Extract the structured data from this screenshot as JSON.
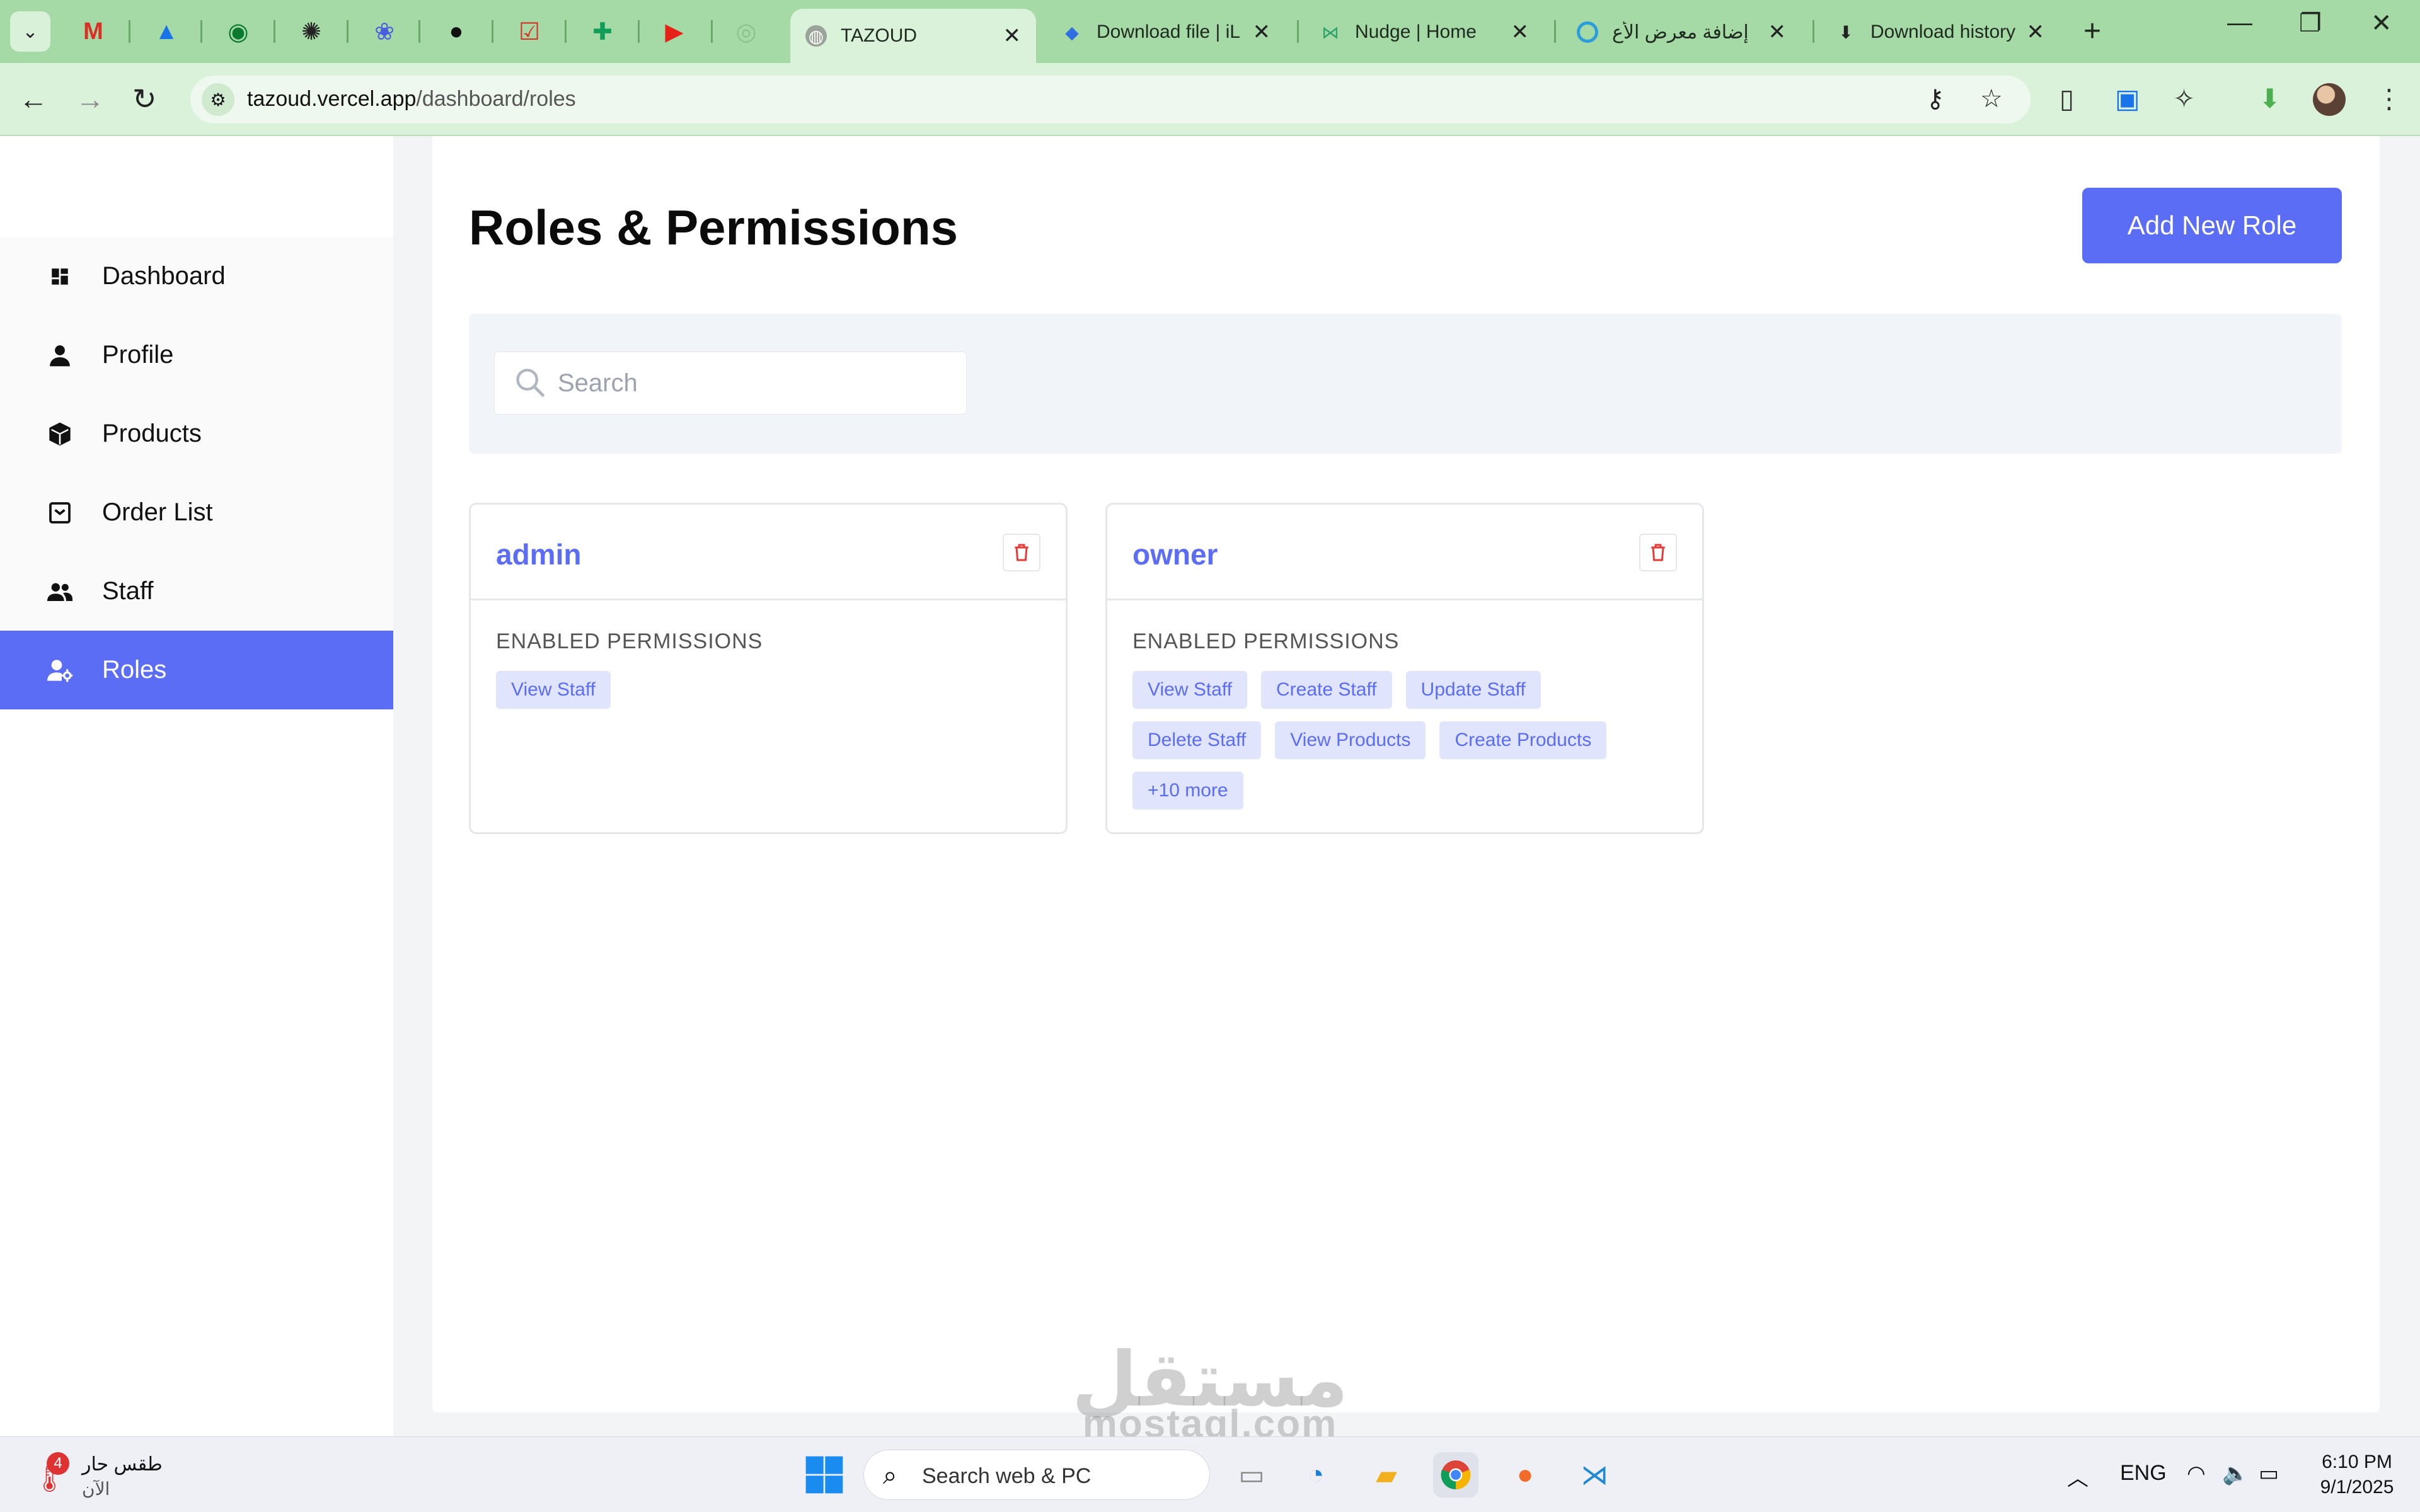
{
  "browser": {
    "tabs": [
      {
        "title": "TAZOUD",
        "active": true
      },
      {
        "title": "Download file | iL"
      },
      {
        "title": "Nudge | Home"
      },
      {
        "title": "إضافة معرض الأع"
      },
      {
        "title": "Download history"
      }
    ],
    "address": {
      "host": "tazoud.vercel.app",
      "path": "/dashboard/roles"
    }
  },
  "sidebar": {
    "items": [
      {
        "label": "Dashboard",
        "icon": "dashboard-icon"
      },
      {
        "label": "Profile",
        "icon": "user-icon"
      },
      {
        "label": "Products",
        "icon": "box-icon"
      },
      {
        "label": "Order List",
        "icon": "order-icon"
      },
      {
        "label": "Staff",
        "icon": "staff-icon"
      },
      {
        "label": "Roles",
        "icon": "roles-icon",
        "active": true
      }
    ]
  },
  "main": {
    "title": "Roles & Permissions",
    "add_button": "Add New Role",
    "search_placeholder": "Search",
    "permissions_heading": "ENABLED PERMISSIONS",
    "roles": [
      {
        "name": "admin",
        "permissions": [
          "View Staff"
        ]
      },
      {
        "name": "owner",
        "permissions": [
          "View Staff",
          "Create Staff",
          "Update Staff",
          "Delete Staff",
          "View Products",
          "Create Products",
          "+10 more"
        ]
      }
    ]
  },
  "watermark": {
    "arabic": "مستقل",
    "latin": "mostaql.com"
  },
  "taskbar": {
    "weather_text": "طقس حار",
    "weather_sub": "الآن",
    "weather_badge": "4",
    "search_label": "Search web & PC",
    "language": "ENG",
    "time": "6:10 PM",
    "date": "9/1/2025"
  },
  "colors": {
    "accent": "#5b6cf5",
    "chip_bg": "#e0e5fd",
    "chrome": "#a5d9a5",
    "delete": "#e53935"
  }
}
